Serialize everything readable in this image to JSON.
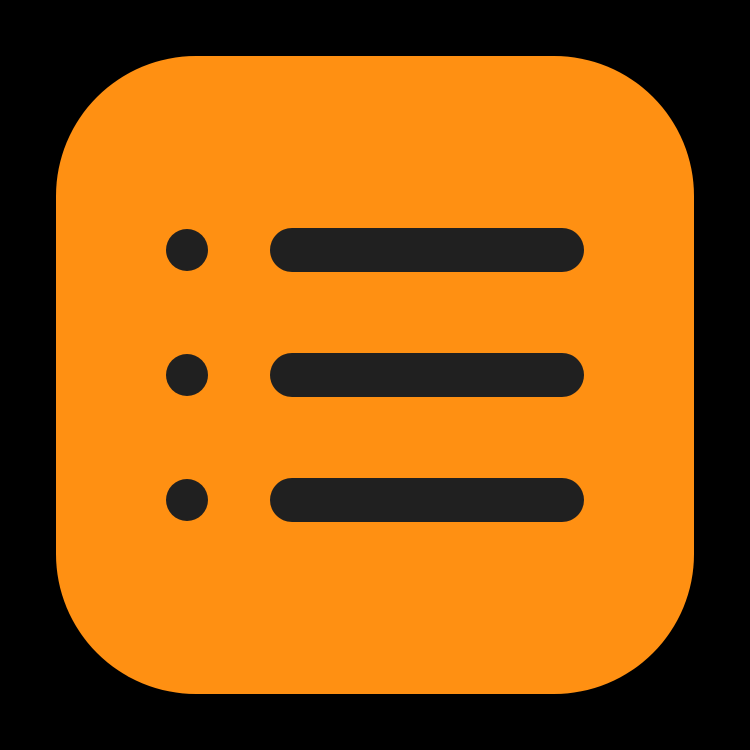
{
  "icon": {
    "name": "list-bullet-icon",
    "background_color": "#000000",
    "tile_color": "#FF9012",
    "glyph_color": "#202020",
    "rows": [
      {
        "bullet_icon": "bullet-dot-icon",
        "line_icon": "list-line-icon"
      },
      {
        "bullet_icon": "bullet-dot-icon",
        "line_icon": "list-line-icon"
      },
      {
        "bullet_icon": "bullet-dot-icon",
        "line_icon": "list-line-icon"
      }
    ]
  }
}
